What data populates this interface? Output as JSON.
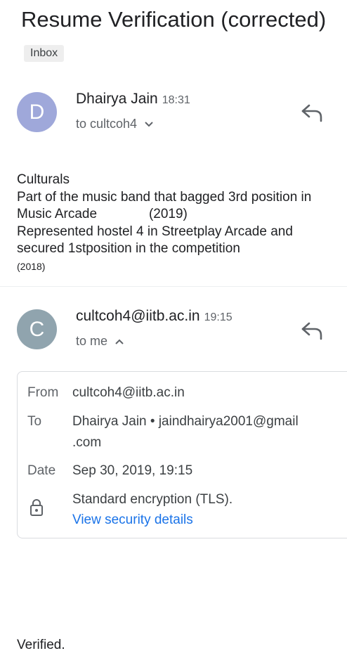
{
  "email": {
    "subject": "Resume Verification (corrected)",
    "label": "Inbox"
  },
  "message1": {
    "avatar_letter": "D",
    "avatar_color": "#9fa8da",
    "sender": "Dhairya Jain",
    "time": "18:31",
    "to_line": "to cultcoh4",
    "body_lines": [
      "Culturals",
      "Part of the music band that bagged 3rd position in",
      "Music Arcade              (2019)",
      "Represented hostel 4 in Streetplay Arcade and",
      "secured 1stposition in the competition"
    ],
    "body_small": "(2018)"
  },
  "message2": {
    "avatar_letter": "C",
    "avatar_color": "#90a4ae",
    "sender": "cultcoh4@iitb.ac.in",
    "time": "19:15",
    "to_line": "to me",
    "details": {
      "from_label": "From",
      "from_value": "cultcoh4@iitb.ac.in",
      "to_label": "To",
      "to_value_line1": "Dhairya Jain • jaindhairya2001@gmail",
      "to_value_line2": ".com",
      "date_label": "Date",
      "date_value": "Sep 30, 2019, 19:15",
      "encryption_text": "Standard encryption (TLS).",
      "security_link": "View security details"
    },
    "body_text": "Verified."
  },
  "colors": {
    "accent_link": "#1a73e8",
    "icon_gray": "#5f6368"
  }
}
